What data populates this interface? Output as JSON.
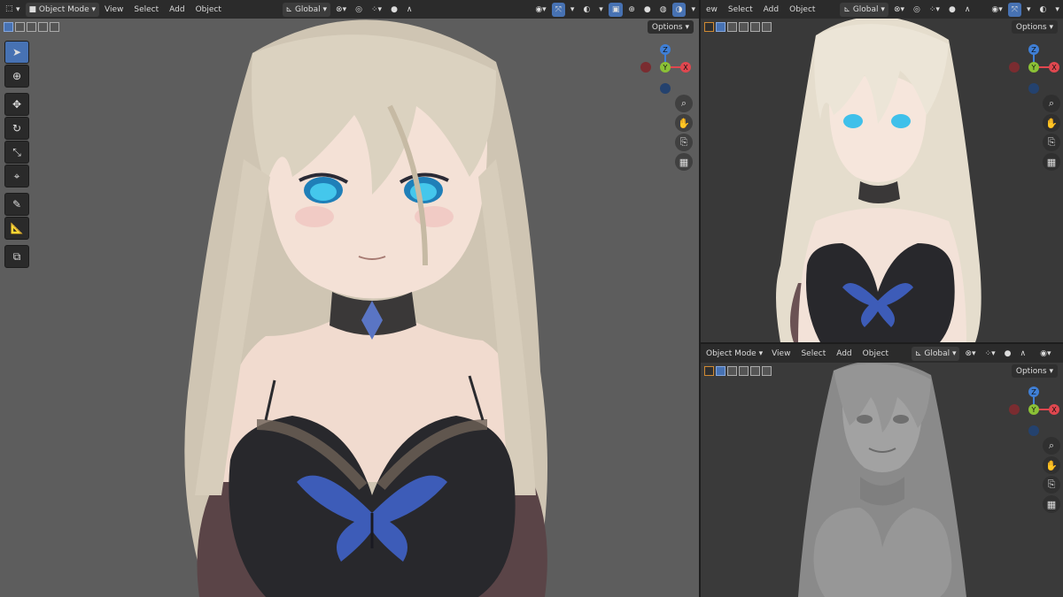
{
  "main": {
    "header": {
      "mode": "Object Mode",
      "menus": [
        "View",
        "Select",
        "Add",
        "Object"
      ],
      "transform": "Global"
    },
    "options_label": "Options",
    "tools": [
      "select-box",
      "cursor",
      "move",
      "rotate",
      "scale",
      "transform",
      "annotate",
      "measure",
      "add-cube"
    ]
  },
  "top_right": {
    "header": {
      "menus": [
        "ew",
        "Select",
        "Add",
        "Object"
      ],
      "transform": "Global"
    },
    "options_label": "Options"
  },
  "bottom_right": {
    "header": {
      "mode": "Object Mode",
      "menus": [
        "View",
        "Select",
        "Add",
        "Object"
      ],
      "transform": "Global"
    },
    "options_label": "Options"
  },
  "gizmo": {
    "x": "X",
    "y": "Y",
    "z": "Z"
  },
  "colors": {
    "x_axis": "#e0474f",
    "y_axis": "#8bc136",
    "z_axis": "#3f7fd6",
    "accent": "#4772b3",
    "hair": "#d9cfbd",
    "skin": "#f2ddd2",
    "eyes": "#38b9e3",
    "dress": "#27272b",
    "butterfly": "#3d5cb8"
  }
}
